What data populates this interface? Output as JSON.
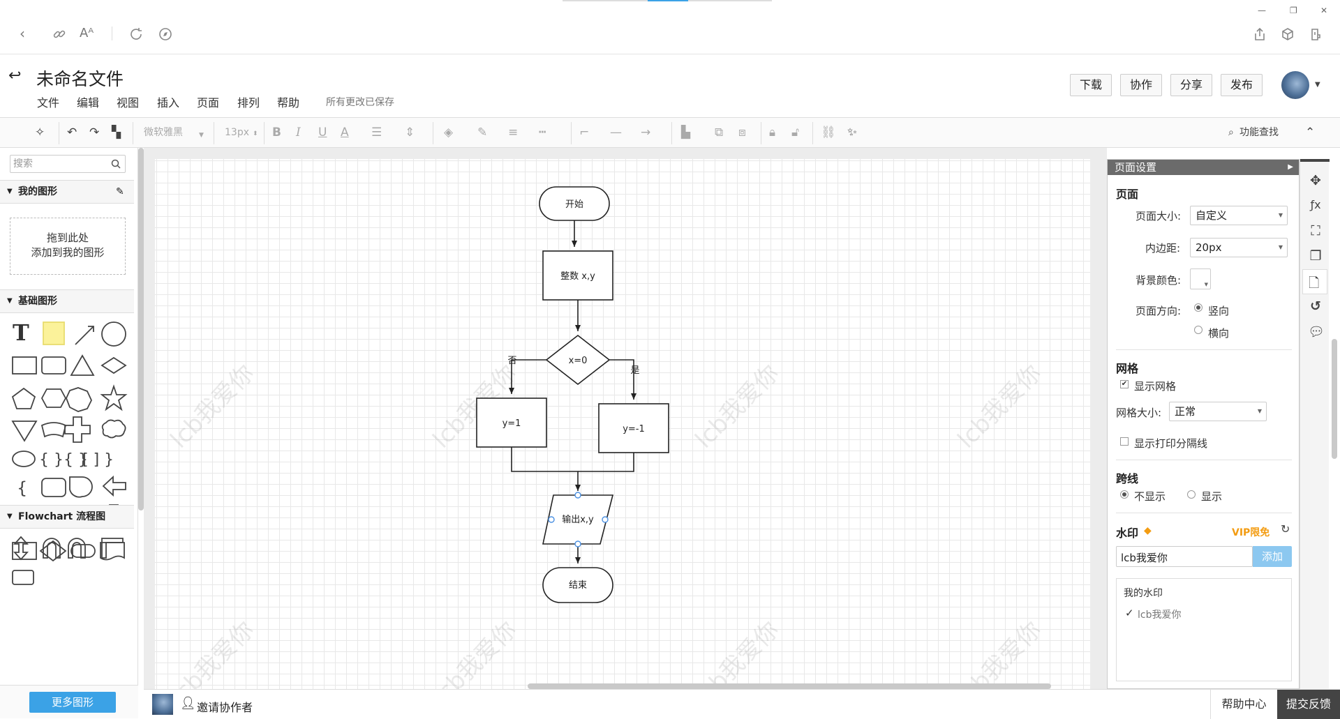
{
  "browser": {
    "win_min": "—",
    "win_restore": "❐",
    "win_close": "✕"
  },
  "header": {
    "back": "↩",
    "title": "未命名文件",
    "menu": [
      "文件",
      "编辑",
      "视图",
      "插入",
      "页面",
      "排列",
      "帮助"
    ],
    "saved_status": "所有更改已保存",
    "buttons": {
      "download": "下载",
      "collaborate": "协作",
      "share": "分享",
      "publish": "发布"
    }
  },
  "toolbar": {
    "font_name": "微软雅黑",
    "font_size": "13px",
    "feature_search": "功能查找"
  },
  "left_panel": {
    "search_placeholder": "搜索",
    "my_shapes_title": "我的图形",
    "drop_line1": "拖到此处",
    "drop_line2": "添加到我的图形",
    "basic_shapes_title": "基础图形",
    "flowchart_title": "Flowchart 流程图",
    "more_shapes": "更多图形"
  },
  "diagram": {
    "start": "开始",
    "declare": "整数 x,y",
    "decision": "x=0",
    "no_label": "否",
    "yes_label": "是",
    "left_box": "y=1",
    "right_box": "y=-1",
    "output": "输出x,y",
    "end": "结束",
    "watermark": "lcb我爱你"
  },
  "right_panel": {
    "title": "页面设置",
    "page_section": "页面",
    "page_size_label": "页面大小:",
    "page_size_value": "自定义",
    "padding_label": "内边距:",
    "padding_value": "20px",
    "bg_color_label": "背景颜色:",
    "orientation_label": "页面方向:",
    "orientation_portrait": "竖向",
    "orientation_landscape": "横向",
    "grid_section": "网格",
    "show_grid": "显示网格",
    "grid_size_label": "网格大小:",
    "grid_size_value": "正常",
    "show_print_lines": "显示打印分隔线",
    "jump_section": "跨线",
    "jump_hide": "不显示",
    "jump_show": "显示",
    "watermark_section": "水印",
    "vip_label": "VIP限免",
    "watermark_input": "lcb我爱你",
    "add_button": "添加",
    "my_watermark": "我的水印",
    "watermark_item": "lcb我爱你"
  },
  "status": {
    "invite": "邀请协作者",
    "help_center": "帮助中心",
    "feedback": "提交反馈"
  },
  "colors": {
    "accent": "#3ba2e6",
    "vip": "#f39c12",
    "feedback_bg": "#444444"
  }
}
